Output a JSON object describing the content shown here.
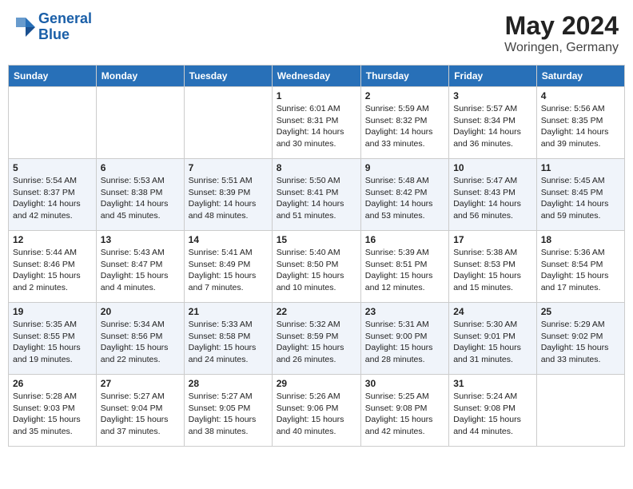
{
  "header": {
    "logo_line1": "General",
    "logo_line2": "Blue",
    "main_title": "May 2024",
    "subtitle": "Woringen, Germany"
  },
  "days_of_week": [
    "Sunday",
    "Monday",
    "Tuesday",
    "Wednesday",
    "Thursday",
    "Friday",
    "Saturday"
  ],
  "weeks": [
    [
      {
        "day": "",
        "sunrise": "",
        "sunset": "",
        "daylight": ""
      },
      {
        "day": "",
        "sunrise": "",
        "sunset": "",
        "daylight": ""
      },
      {
        "day": "",
        "sunrise": "",
        "sunset": "",
        "daylight": ""
      },
      {
        "day": "1",
        "sunrise": "Sunrise: 6:01 AM",
        "sunset": "Sunset: 8:31 PM",
        "daylight": "Daylight: 14 hours and 30 minutes."
      },
      {
        "day": "2",
        "sunrise": "Sunrise: 5:59 AM",
        "sunset": "Sunset: 8:32 PM",
        "daylight": "Daylight: 14 hours and 33 minutes."
      },
      {
        "day": "3",
        "sunrise": "Sunrise: 5:57 AM",
        "sunset": "Sunset: 8:34 PM",
        "daylight": "Daylight: 14 hours and 36 minutes."
      },
      {
        "day": "4",
        "sunrise": "Sunrise: 5:56 AM",
        "sunset": "Sunset: 8:35 PM",
        "daylight": "Daylight: 14 hours and 39 minutes."
      }
    ],
    [
      {
        "day": "5",
        "sunrise": "Sunrise: 5:54 AM",
        "sunset": "Sunset: 8:37 PM",
        "daylight": "Daylight: 14 hours and 42 minutes."
      },
      {
        "day": "6",
        "sunrise": "Sunrise: 5:53 AM",
        "sunset": "Sunset: 8:38 PM",
        "daylight": "Daylight: 14 hours and 45 minutes."
      },
      {
        "day": "7",
        "sunrise": "Sunrise: 5:51 AM",
        "sunset": "Sunset: 8:39 PM",
        "daylight": "Daylight: 14 hours and 48 minutes."
      },
      {
        "day": "8",
        "sunrise": "Sunrise: 5:50 AM",
        "sunset": "Sunset: 8:41 PM",
        "daylight": "Daylight: 14 hours and 51 minutes."
      },
      {
        "day": "9",
        "sunrise": "Sunrise: 5:48 AM",
        "sunset": "Sunset: 8:42 PM",
        "daylight": "Daylight: 14 hours and 53 minutes."
      },
      {
        "day": "10",
        "sunrise": "Sunrise: 5:47 AM",
        "sunset": "Sunset: 8:43 PM",
        "daylight": "Daylight: 14 hours and 56 minutes."
      },
      {
        "day": "11",
        "sunrise": "Sunrise: 5:45 AM",
        "sunset": "Sunset: 8:45 PM",
        "daylight": "Daylight: 14 hours and 59 minutes."
      }
    ],
    [
      {
        "day": "12",
        "sunrise": "Sunrise: 5:44 AM",
        "sunset": "Sunset: 8:46 PM",
        "daylight": "Daylight: 15 hours and 2 minutes."
      },
      {
        "day": "13",
        "sunrise": "Sunrise: 5:43 AM",
        "sunset": "Sunset: 8:47 PM",
        "daylight": "Daylight: 15 hours and 4 minutes."
      },
      {
        "day": "14",
        "sunrise": "Sunrise: 5:41 AM",
        "sunset": "Sunset: 8:49 PM",
        "daylight": "Daylight: 15 hours and 7 minutes."
      },
      {
        "day": "15",
        "sunrise": "Sunrise: 5:40 AM",
        "sunset": "Sunset: 8:50 PM",
        "daylight": "Daylight: 15 hours and 10 minutes."
      },
      {
        "day": "16",
        "sunrise": "Sunrise: 5:39 AM",
        "sunset": "Sunset: 8:51 PM",
        "daylight": "Daylight: 15 hours and 12 minutes."
      },
      {
        "day": "17",
        "sunrise": "Sunrise: 5:38 AM",
        "sunset": "Sunset: 8:53 PM",
        "daylight": "Daylight: 15 hours and 15 minutes."
      },
      {
        "day": "18",
        "sunrise": "Sunrise: 5:36 AM",
        "sunset": "Sunset: 8:54 PM",
        "daylight": "Daylight: 15 hours and 17 minutes."
      }
    ],
    [
      {
        "day": "19",
        "sunrise": "Sunrise: 5:35 AM",
        "sunset": "Sunset: 8:55 PM",
        "daylight": "Daylight: 15 hours and 19 minutes."
      },
      {
        "day": "20",
        "sunrise": "Sunrise: 5:34 AM",
        "sunset": "Sunset: 8:56 PM",
        "daylight": "Daylight: 15 hours and 22 minutes."
      },
      {
        "day": "21",
        "sunrise": "Sunrise: 5:33 AM",
        "sunset": "Sunset: 8:58 PM",
        "daylight": "Daylight: 15 hours and 24 minutes."
      },
      {
        "day": "22",
        "sunrise": "Sunrise: 5:32 AM",
        "sunset": "Sunset: 8:59 PM",
        "daylight": "Daylight: 15 hours and 26 minutes."
      },
      {
        "day": "23",
        "sunrise": "Sunrise: 5:31 AM",
        "sunset": "Sunset: 9:00 PM",
        "daylight": "Daylight: 15 hours and 28 minutes."
      },
      {
        "day": "24",
        "sunrise": "Sunrise: 5:30 AM",
        "sunset": "Sunset: 9:01 PM",
        "daylight": "Daylight: 15 hours and 31 minutes."
      },
      {
        "day": "25",
        "sunrise": "Sunrise: 5:29 AM",
        "sunset": "Sunset: 9:02 PM",
        "daylight": "Daylight: 15 hours and 33 minutes."
      }
    ],
    [
      {
        "day": "26",
        "sunrise": "Sunrise: 5:28 AM",
        "sunset": "Sunset: 9:03 PM",
        "daylight": "Daylight: 15 hours and 35 minutes."
      },
      {
        "day": "27",
        "sunrise": "Sunrise: 5:27 AM",
        "sunset": "Sunset: 9:04 PM",
        "daylight": "Daylight: 15 hours and 37 minutes."
      },
      {
        "day": "28",
        "sunrise": "Sunrise: 5:27 AM",
        "sunset": "Sunset: 9:05 PM",
        "daylight": "Daylight: 15 hours and 38 minutes."
      },
      {
        "day": "29",
        "sunrise": "Sunrise: 5:26 AM",
        "sunset": "Sunset: 9:06 PM",
        "daylight": "Daylight: 15 hours and 40 minutes."
      },
      {
        "day": "30",
        "sunrise": "Sunrise: 5:25 AM",
        "sunset": "Sunset: 9:08 PM",
        "daylight": "Daylight: 15 hours and 42 minutes."
      },
      {
        "day": "31",
        "sunrise": "Sunrise: 5:24 AM",
        "sunset": "Sunset: 9:08 PM",
        "daylight": "Daylight: 15 hours and 44 minutes."
      },
      {
        "day": "",
        "sunrise": "",
        "sunset": "",
        "daylight": ""
      }
    ]
  ]
}
